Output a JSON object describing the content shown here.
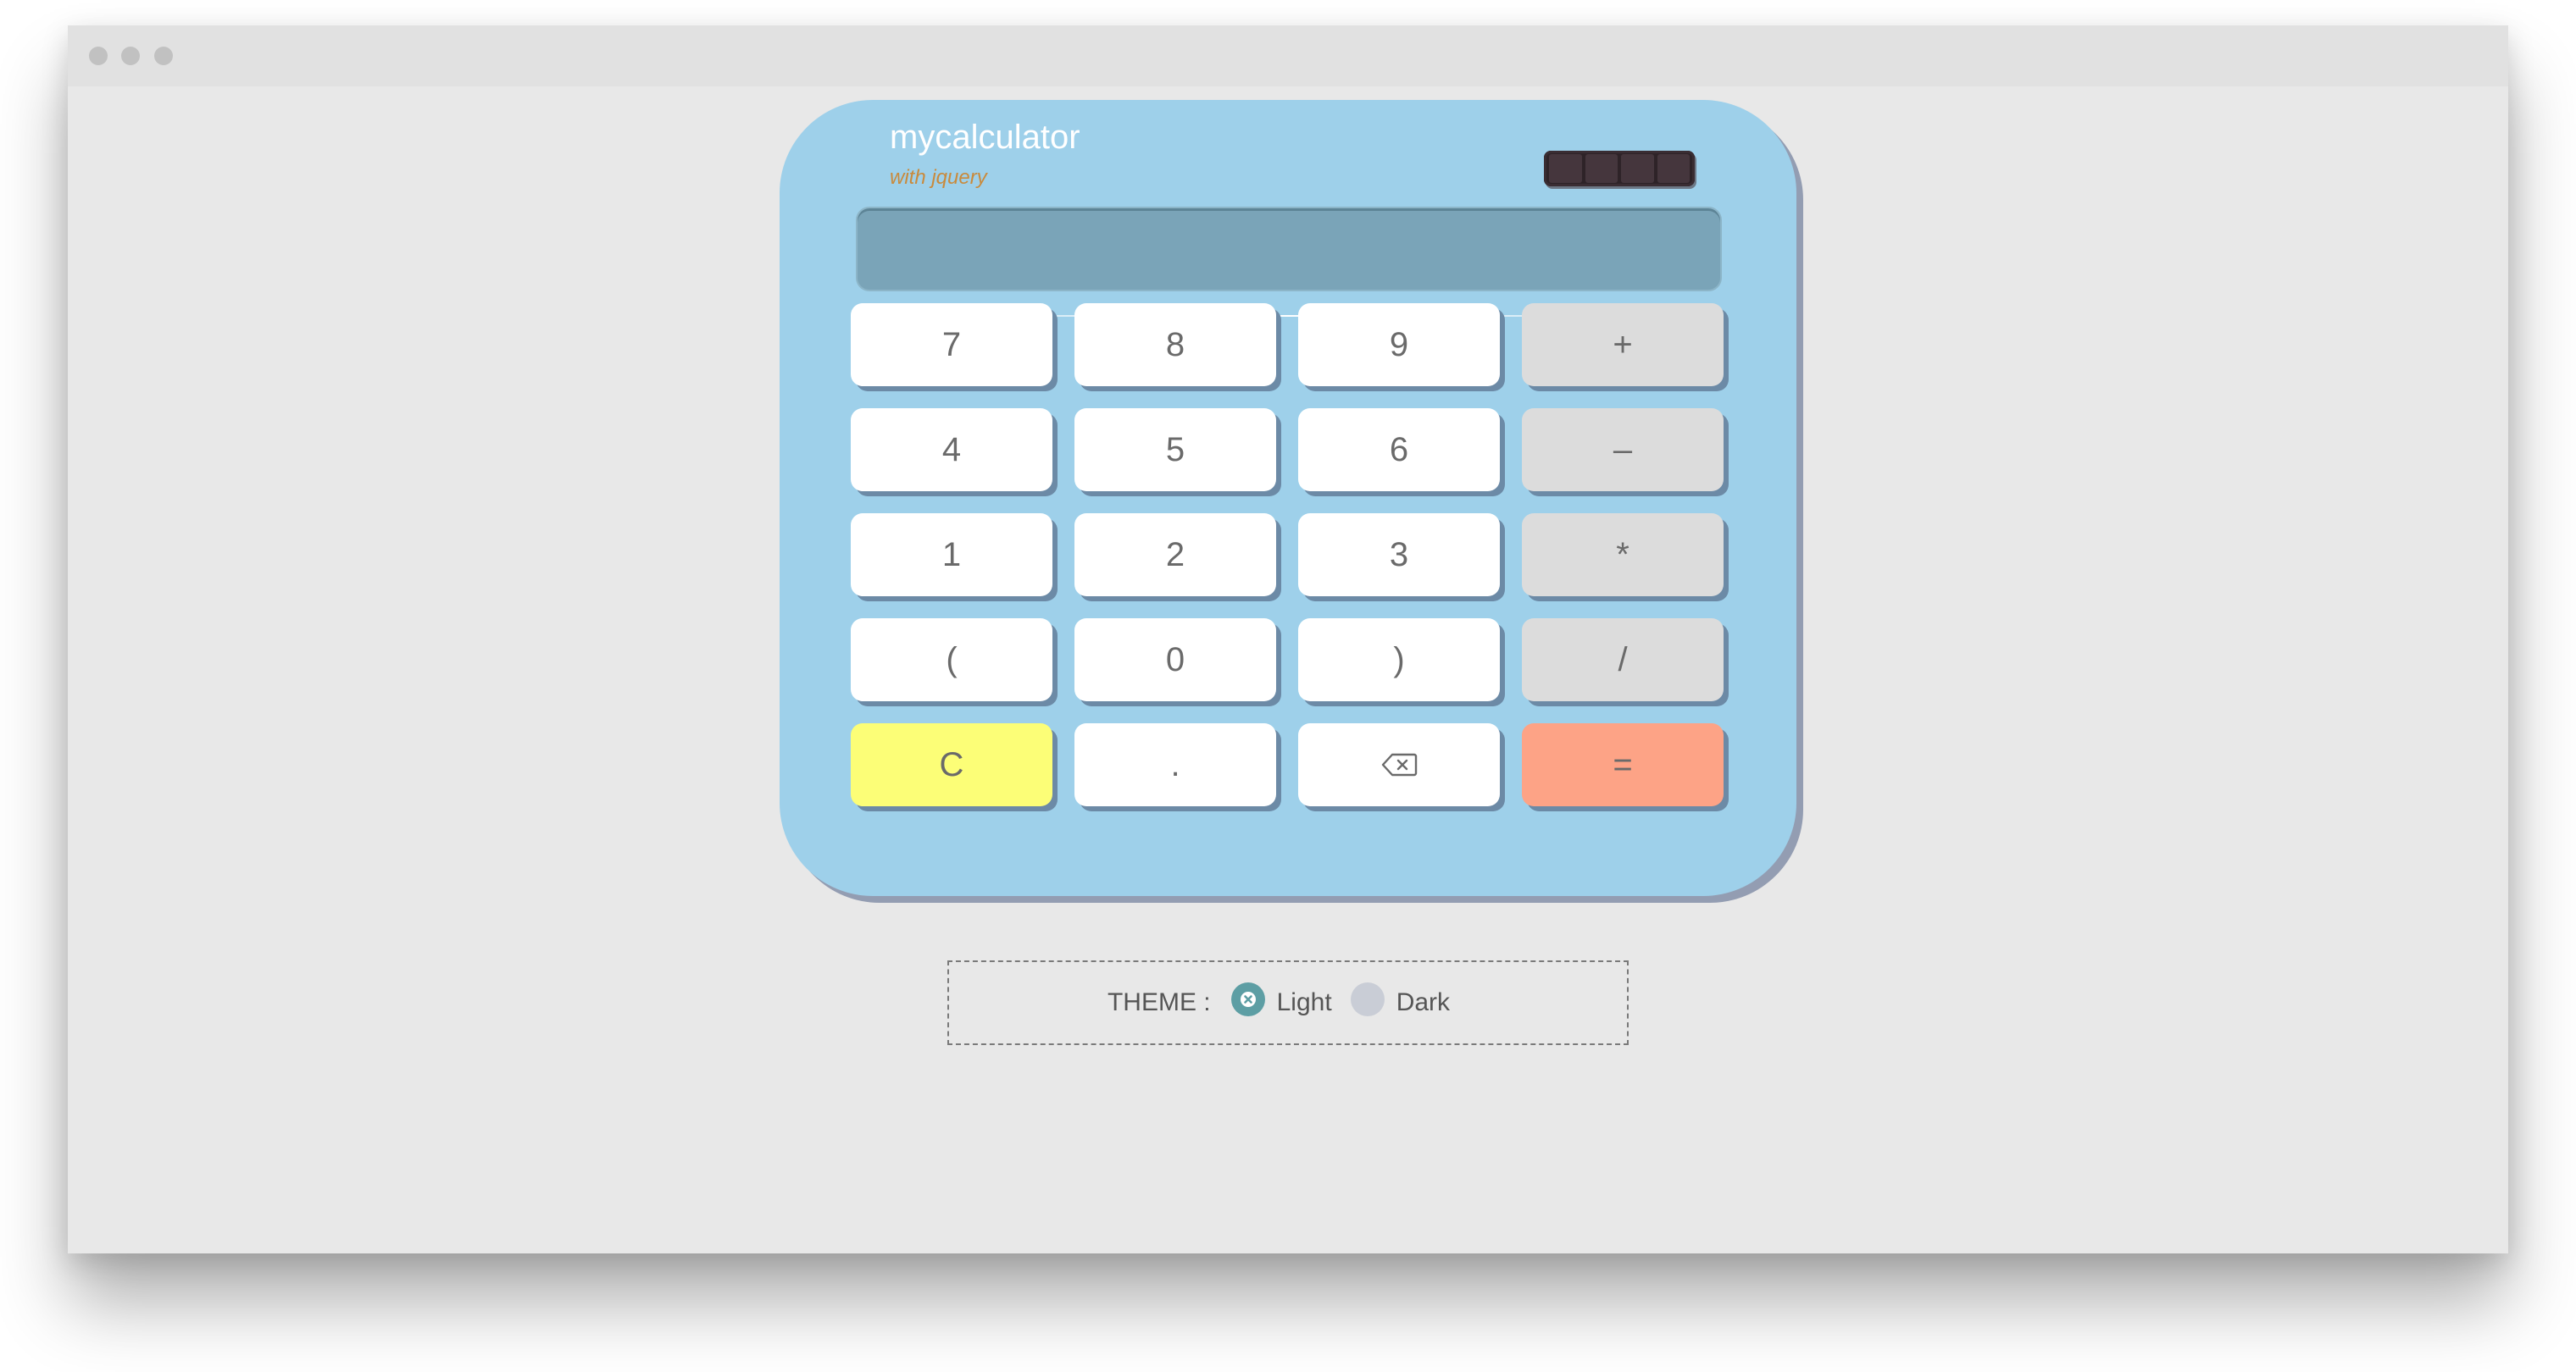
{
  "window": {
    "controls": [
      "close",
      "minimize",
      "maximize"
    ]
  },
  "calculator": {
    "brand": "mycalculator",
    "subtitle": "with jquery",
    "display_value": "",
    "keys": [
      {
        "label": "7",
        "type": "digit",
        "name": "key-7"
      },
      {
        "label": "8",
        "type": "digit",
        "name": "key-8"
      },
      {
        "label": "9",
        "type": "digit",
        "name": "key-9"
      },
      {
        "label": "+",
        "type": "operator",
        "name": "key-plus"
      },
      {
        "label": "4",
        "type": "digit",
        "name": "key-4"
      },
      {
        "label": "5",
        "type": "digit",
        "name": "key-5"
      },
      {
        "label": "6",
        "type": "digit",
        "name": "key-6"
      },
      {
        "label": "–",
        "type": "operator",
        "name": "key-minus"
      },
      {
        "label": "1",
        "type": "digit",
        "name": "key-1"
      },
      {
        "label": "2",
        "type": "digit",
        "name": "key-2"
      },
      {
        "label": "3",
        "type": "digit",
        "name": "key-3"
      },
      {
        "label": "*",
        "type": "operator",
        "name": "key-multiply"
      },
      {
        "label": "(",
        "type": "digit",
        "name": "key-open-paren"
      },
      {
        "label": "0",
        "type": "digit",
        "name": "key-0"
      },
      {
        "label": ")",
        "type": "digit",
        "name": "key-close-paren"
      },
      {
        "label": "/",
        "type": "operator",
        "name": "key-divide"
      },
      {
        "label": "C",
        "type": "clear",
        "name": "key-clear"
      },
      {
        "label": ".",
        "type": "digit",
        "name": "key-decimal"
      },
      {
        "label": "",
        "type": "backspace",
        "name": "key-backspace",
        "icon": "backspace-icon"
      },
      {
        "label": "=",
        "type": "equals",
        "name": "key-equals"
      }
    ]
  },
  "theme": {
    "label": "THEME :",
    "options": [
      {
        "label": "Light",
        "selected": true
      },
      {
        "label": "Dark",
        "selected": false
      }
    ]
  },
  "colors": {
    "page_background": "#e8e8e8",
    "calculator_body": "#9ed0ea",
    "display": "#7aa4b8",
    "digit_key": "#ffffff",
    "operator_key": "#dcdcdc",
    "clear_key": "#fcfe77",
    "equals_key": "#fda386",
    "subtitle": "#c98a3c",
    "radio_selected": "#5d9ea4",
    "radio_unselected": "#c9cdd6"
  }
}
